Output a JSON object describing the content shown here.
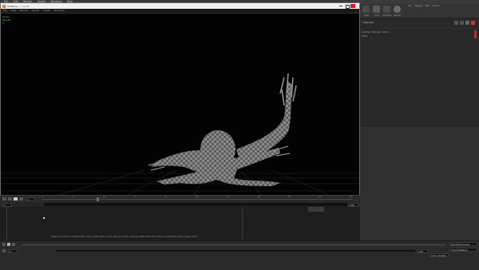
{
  "host": {
    "menu": [
      "File",
      "Edit",
      "Render",
      "Assets",
      "Windows",
      "Help"
    ],
    "right_tabs": [
      "Set",
      "Rigging",
      "Edit",
      "Render"
    ]
  },
  "window": {
    "title": "HDRI/Ue... — ls:c3",
    "menu": [
      "File",
      "View",
      "Render",
      "Assets",
      "Image",
      "Windows"
    ],
    "viewport_info": [
      "persp",
      "Render",
      "1"
    ]
  },
  "right_panel": {
    "toolbar_labels": [
      "Shelf",
      "Tools",
      "Geometry",
      "Render",
      "Sample"
    ],
    "path": "/obj/root1",
    "list_items": [
      "lookdev: 6x6 grid, 4.20.1",
      "root1"
    ]
  },
  "playback": {
    "start_frame": "1",
    "current_frame": "1",
    "end_frame": "240",
    "frame_ticks": [
      "1",
      "24",
      "48",
      "72",
      "96",
      "120",
      "144",
      "168",
      "192",
      "216",
      "240"
    ]
  },
  "status": {
    "hint": "Select and transform: Middle-button: Move. Right-button: Scroll. Left-click: Select. Alt-drag: Rotate. Shift-click: Select. Ctrl-drag: Box-select. Wheel: Zoom."
  },
  "bottom": {
    "frame_left": "1",
    "frame_right": "240",
    "right_fields": [
      "Keys/Ch/Curves",
      "Chan/All/Keys",
      "Auto Update"
    ]
  },
  "colors": {
    "viewport_bg": "#030303",
    "info_text": "#5fd35f",
    "panel": "#2f2f2f",
    "accent_red": "#c0392b"
  }
}
